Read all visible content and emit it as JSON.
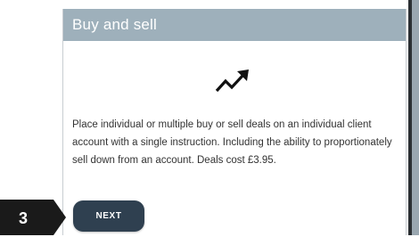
{
  "card": {
    "title": "Buy and sell",
    "icon": "trending-up-icon",
    "description": "Place individual or multiple buy or sell deals on an individual client account with a single instruction. Including the ability to proportionately sell down from an account. Deals cost £3.95."
  },
  "step": {
    "number": "3"
  },
  "actions": {
    "next_label": "NEXT"
  },
  "colors": {
    "header_bg": "#9eb0bb",
    "button_bg": "#2f4050",
    "badge_bg": "#1a1a1a",
    "text": "#333333"
  }
}
